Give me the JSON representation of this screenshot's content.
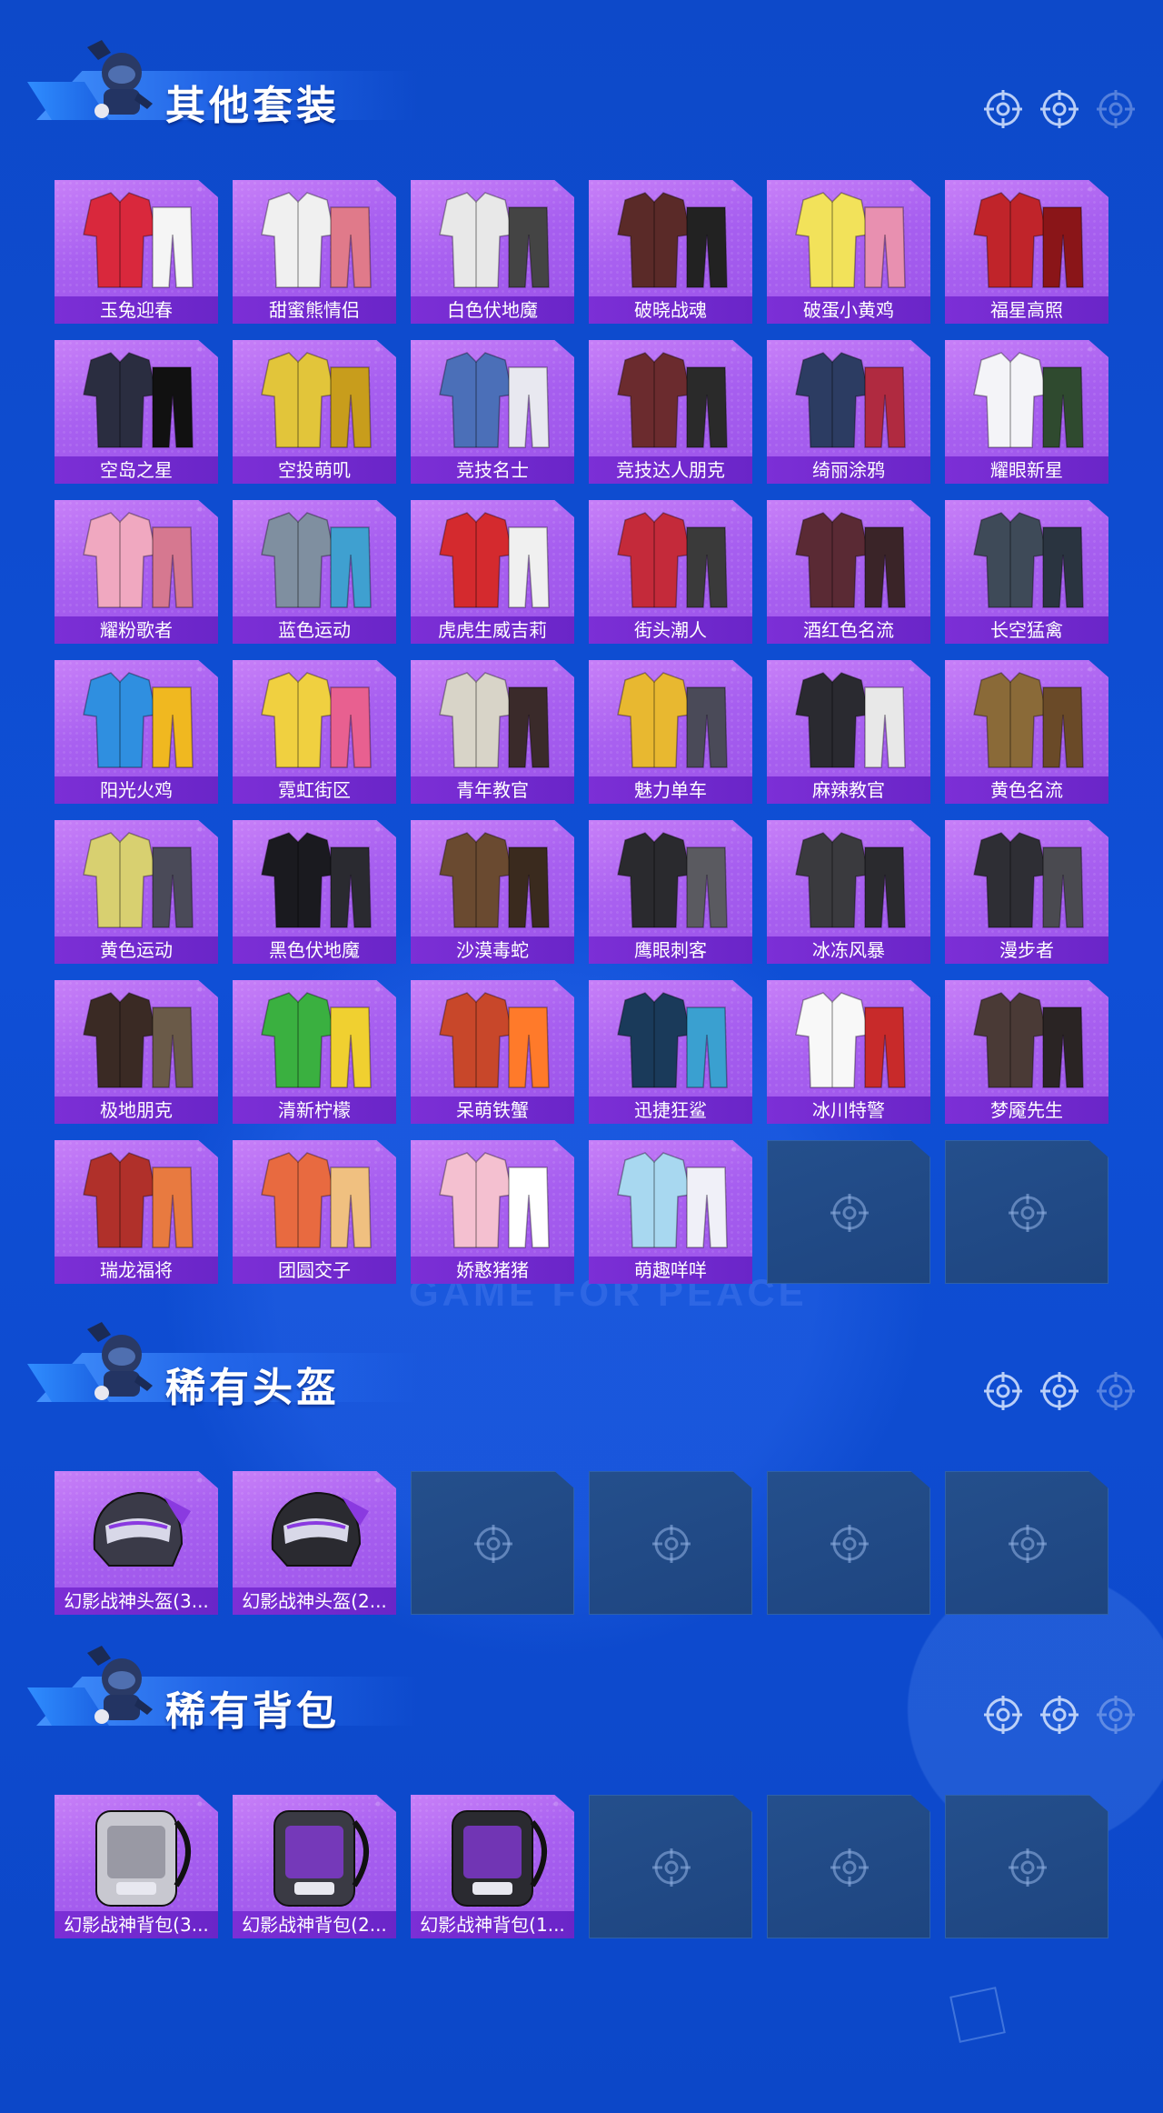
{
  "watermark": "GAME FOR PEACE",
  "colors": {
    "background": "#0f4fd6",
    "tile_filled": "#a860f0",
    "tile_label": "#7c2fd6",
    "tile_empty": "#224a86"
  },
  "sections": [
    {
      "title": "其他套装",
      "icons": [
        "target-icon",
        "target-icon",
        "target-icon"
      ],
      "items": [
        "玉兔迎春",
        "甜蜜熊情侣",
        "白色伏地魔",
        "破晓战魂",
        "破蛋小黄鸡",
        "福星高照",
        "空岛之星",
        "空投萌叽",
        "竞技名士",
        "竞技达人朋克",
        "绮丽涂鸦",
        "耀眼新星",
        "耀粉歌者",
        "蓝色运动",
        "虎虎生威吉莉",
        "街头潮人",
        "酒红色名流",
        "长空猛禽",
        "阳光火鸡",
        "霓虹街区",
        "青年教官",
        "魅力单车",
        "麻辣教官",
        "黄色名流",
        "黄色运动",
        "黑色伏地魔",
        "沙漠毒蛇",
        "鹰眼刺客",
        "冰冻风暴",
        "漫步者",
        "极地朋克",
        "清新柠檬",
        "呆萌铁蟹",
        "迅捷狂鲨",
        "冰川特警",
        "梦魇先生",
        "瑞龙福将",
        "团圆交子",
        "娇憨猪猪",
        "萌趣咩咩"
      ],
      "empty_slots": 2
    },
    {
      "title": "稀有头盔",
      "icons": [
        "target-icon",
        "target-icon",
        "target-icon"
      ],
      "items": [
        "幻影战神头盔(3...",
        "幻影战神头盔(2..."
      ],
      "empty_slots": 4
    },
    {
      "title": "稀有背包",
      "icons": [
        "target-icon",
        "target-icon",
        "target-icon"
      ],
      "items": [
        "幻影战神背包(3...",
        "幻影战神背包(2...",
        "幻影战神背包(1..."
      ],
      "empty_slots": 3
    }
  ]
}
